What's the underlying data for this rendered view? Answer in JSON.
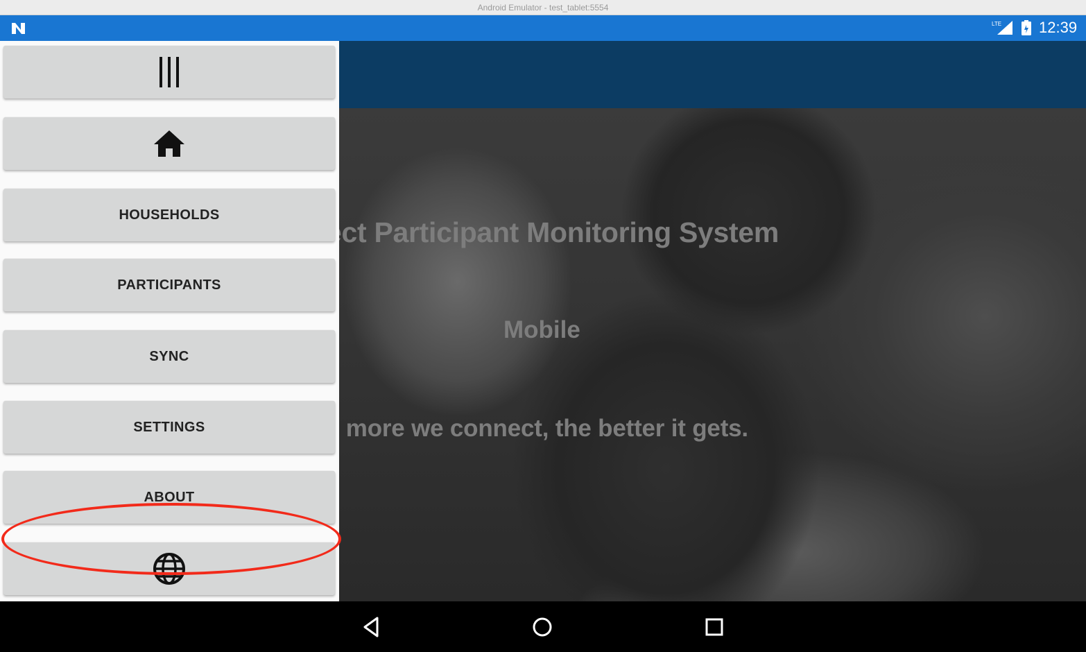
{
  "window": {
    "title": "Android Emulator - test_tablet:5554"
  },
  "status_bar": {
    "time": "12:39",
    "network_label": "LTE",
    "icons": [
      "n-logo-icon",
      "lte-signal-icon",
      "battery-icon"
    ]
  },
  "drawer": {
    "items": [
      {
        "name": "menu-toggle-button",
        "icon": "bars-icon",
        "label": ""
      },
      {
        "name": "home-button",
        "icon": "home-icon",
        "label": ""
      },
      {
        "name": "households-button",
        "icon": "",
        "label": "HOUSEHOLDS"
      },
      {
        "name": "participants-button",
        "icon": "",
        "label": "PARTICIPANTS"
      },
      {
        "name": "sync-button",
        "icon": "",
        "label": "SYNC"
      },
      {
        "name": "settings-button",
        "icon": "",
        "label": "SETTINGS"
      },
      {
        "name": "about-button",
        "icon": "",
        "label": "ABOUT"
      },
      {
        "name": "language-button",
        "icon": "globe-icon",
        "label": ""
      }
    ]
  },
  "hero": {
    "title": "ect Participant Monitoring System",
    "subtitle": "Mobile",
    "tagline": "e more we connect, the better it gets."
  },
  "annotation": {
    "highlighted_item": "ABOUT",
    "color": "#f22a1a"
  },
  "colors": {
    "status_bar": "#1976d2",
    "app_bar": "#0c3c63",
    "drawer_button": "#d6d7d7",
    "drawer_background": "#fafafa"
  },
  "nav_bar": {
    "buttons": [
      "back-icon",
      "home-circle-icon",
      "recents-icon"
    ]
  }
}
